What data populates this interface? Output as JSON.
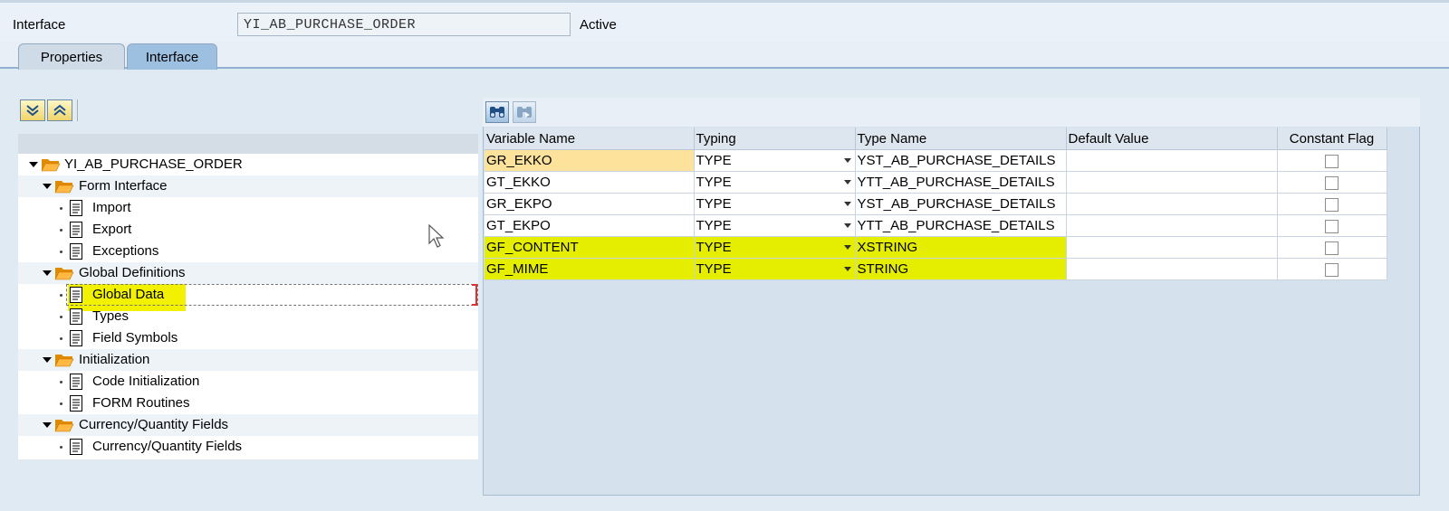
{
  "header": {
    "label": "Interface",
    "value": "YI_AB_PURCHASE_ORDER",
    "status": "Active"
  },
  "tabs": [
    {
      "label": "Properties"
    },
    {
      "label": "Interface"
    }
  ],
  "tree": {
    "root": "YI_AB_PURCHASE_ORDER",
    "nodes": {
      "form_interface": {
        "label": "Form Interface",
        "children": [
          "Import",
          "Export",
          "Exceptions"
        ]
      },
      "global_definitions": {
        "label": "Global Definitions",
        "children": [
          "Global Data",
          "Types",
          "Field Symbols"
        ]
      },
      "initialization": {
        "label": "Initialization",
        "children": [
          "Code Initialization",
          "FORM Routines"
        ]
      },
      "currency_quantity": {
        "label": "Currency/Quantity Fields",
        "children": [
          "Currency/Quantity Fields"
        ]
      }
    }
  },
  "grid": {
    "columns": [
      "Variable Name",
      "Typing",
      "Type Name",
      "Default Value",
      "Constant Flag"
    ],
    "rows": [
      {
        "variable": "GR_EKKO",
        "typing": "TYPE",
        "type_name": "YST_AB_PURCHASE_DETAILS",
        "default_value": "",
        "constant": false
      },
      {
        "variable": "GT_EKKO",
        "typing": "TYPE",
        "type_name": "YTT_AB_PURCHASE_DETAILS",
        "default_value": "",
        "constant": false
      },
      {
        "variable": "GR_EKPO",
        "typing": "TYPE",
        "type_name": "YST_AB_PURCHASE_DETAILS",
        "default_value": "",
        "constant": false
      },
      {
        "variable": "GT_EKPO",
        "typing": "TYPE",
        "type_name": "YTT_AB_PURCHASE_DETAILS",
        "default_value": "",
        "constant": false
      },
      {
        "variable": "GF_CONTENT",
        "typing": "TYPE",
        "type_name": "XSTRING",
        "default_value": "",
        "constant": false
      },
      {
        "variable": "GF_MIME",
        "typing": "TYPE",
        "type_name": "STRING",
        "default_value": "",
        "constant": false
      }
    ]
  },
  "icons": {
    "expand": "expand-all-icon",
    "collapse": "collapse-all-icon",
    "find": "binoculars-icon",
    "find_next": "find-next-icon"
  },
  "colors": {
    "highlight": "#e6ee00",
    "selected_cell": "#fce29b",
    "folder": "#f0a020"
  }
}
